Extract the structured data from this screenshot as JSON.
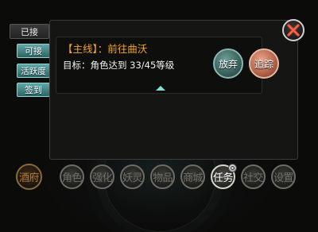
{
  "tabs": {
    "accepted": "已接",
    "available": "可接",
    "activity": "活跃度",
    "signin": "签到"
  },
  "quest": {
    "title": "【主线】：前往曲沃",
    "goal": "目标：角色达到 33/45等级",
    "progress": {
      "current": 33,
      "target": 45
    }
  },
  "actions": {
    "abandon": "放弃",
    "track": "追踪"
  },
  "bottom_menu": {
    "tavern": "酒府",
    "character": "角色",
    "enhance": "强化",
    "spirit": "妖灵",
    "items": "物品",
    "shop": "商城",
    "quests": "任务",
    "social": "社交",
    "settings": "设置"
  },
  "colors": {
    "quest_title": "#f7a621",
    "tab_active": "#2c6664",
    "close_x": "#e8452c"
  }
}
